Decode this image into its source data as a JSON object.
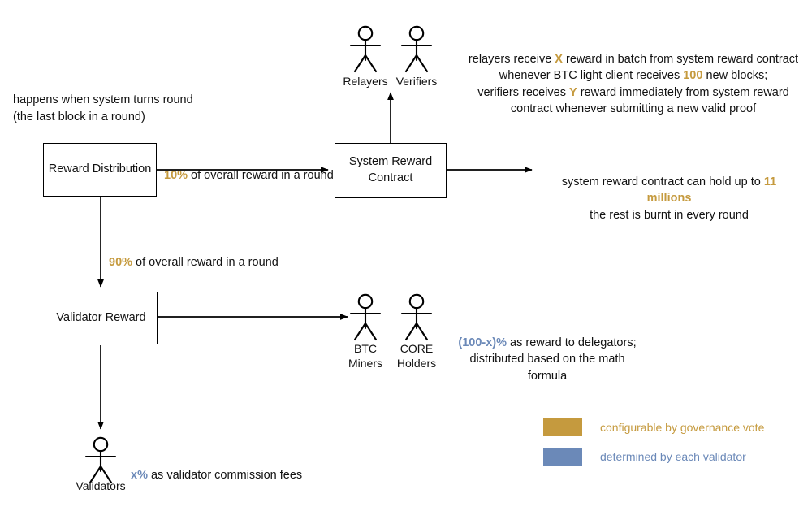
{
  "diagram": {
    "title": "Core Blockchain Reward Distribution",
    "colors": {
      "gold": "#c59a3e",
      "blue": "#6b89b8",
      "stroke": "#000000",
      "background": "#ffffff"
    }
  },
  "nodes": {
    "reward_distribution": {
      "label": "Reward Distribution"
    },
    "system_reward_contract": {
      "label": "System Reward\nContract"
    },
    "validator_reward": {
      "label": "Validator Reward"
    }
  },
  "notes": {
    "round_trigger": "happens when system turns round\n   (the last block in a round)",
    "relayer_verifier": {
      "line1_a": "relayers receive ",
      "line1_b": "X",
      "line1_c": " reward in batch from system reward contract",
      "line2_a": "whenever BTC light client receives ",
      "line2_b": "100",
      "line2_c": " new blocks;",
      "line3_a": "verifiers receives ",
      "line3_b": "Y",
      "line3_c": " reward immediately from system reward",
      "line4": "contract whenever submitting a new valid proof"
    },
    "cap_note": {
      "line1_a": "system reward contract can hold up to ",
      "line1_b": "11 millions",
      "line2": "the rest is burnt in every round"
    },
    "delegator_note": {
      "line1_a": "(100-x)%",
      "line1_b": " as reward to delegators;",
      "line2": "distributed based on the math formula"
    },
    "commission_note": {
      "a": "x%",
      "b": " as validator commission fees"
    }
  },
  "edges": {
    "ten_percent": {
      "value": "10%",
      "rest": " of overall reward in a round"
    },
    "ninety_percent": {
      "value": "90%",
      "rest": " of overall reward in a round"
    }
  },
  "actors": {
    "relayers": {
      "label": "Relayers"
    },
    "verifiers": {
      "label": "Verifiers"
    },
    "btc_miners": {
      "label": "BTC\nMiners"
    },
    "core_holders": {
      "label": "CORE\nHolders"
    },
    "validators": {
      "label": "Validators"
    }
  },
  "legend": {
    "items": [
      {
        "color": "#c59a3e",
        "label": "configurable by governance vote",
        "swatch_name": "gold-swatch"
      },
      {
        "color": "#6b89b8",
        "label": "determined by each validator",
        "swatch_name": "blue-swatch"
      }
    ]
  }
}
